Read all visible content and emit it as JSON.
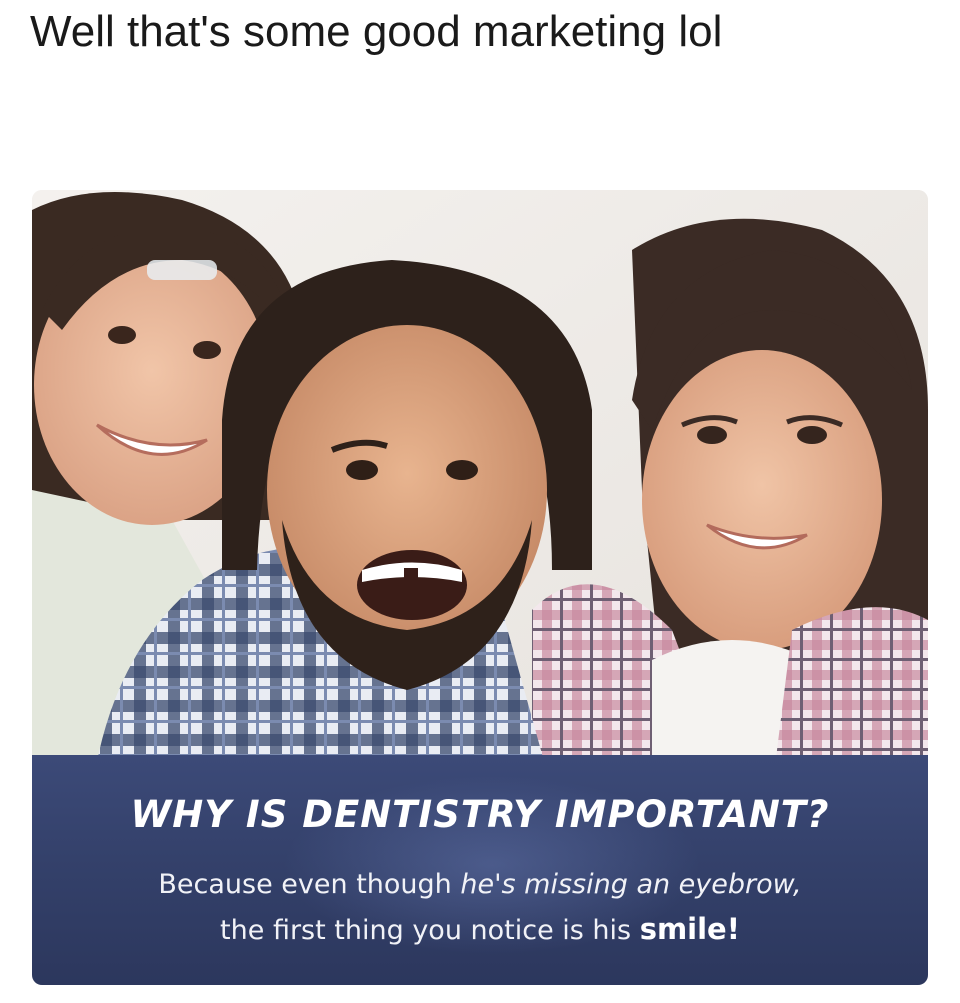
{
  "post": {
    "caption": "Well that's some good marketing lol"
  },
  "ad": {
    "headline": "WHY IS DENTISTRY IMPORTANT?",
    "line1_a": "Because even though ",
    "line1_b": "he's missing an eyebrow,",
    "line2_a": "the first thing you notice is his ",
    "line2_b": "smile!"
  }
}
